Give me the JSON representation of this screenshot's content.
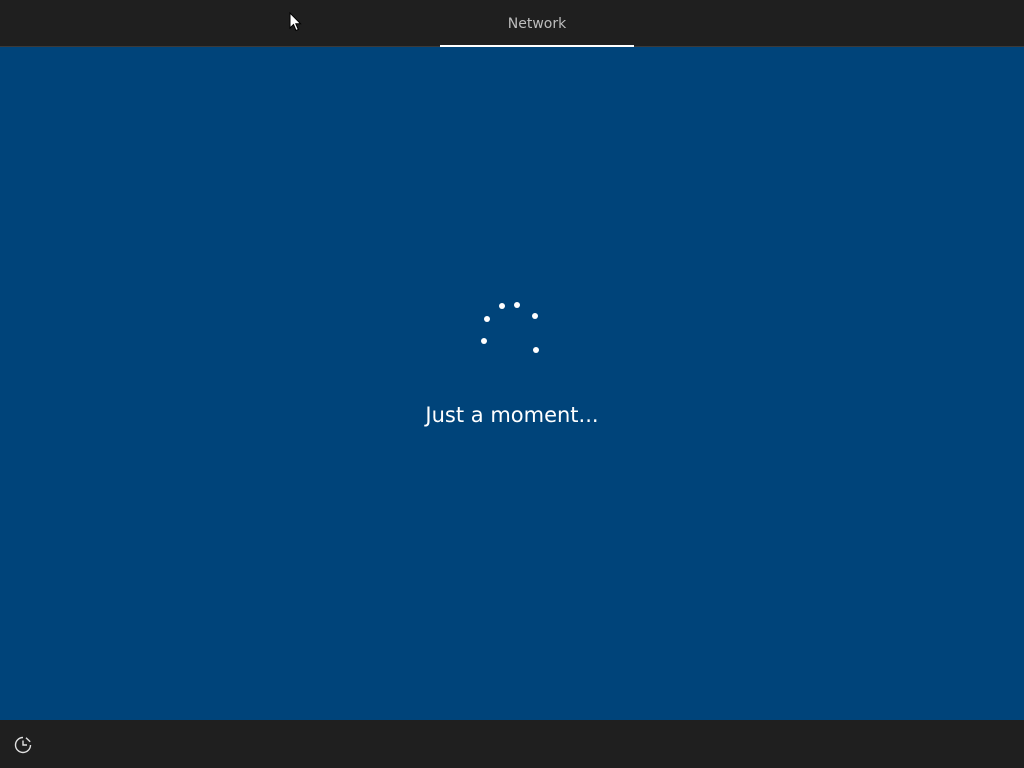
{
  "header": {
    "tabs": [
      {
        "label": "Network",
        "active": true
      }
    ]
  },
  "main": {
    "status_text": "Just a moment...",
    "spinner_icon": "loading-spinner-icon"
  },
  "footer": {
    "ease_of_access_icon": "ease-of-access-icon"
  },
  "colors": {
    "background_main": "#00447a",
    "bar_background": "#1f1f1f",
    "tab_text": "#bdbdbd",
    "accent_underline": "#ffffff",
    "text": "#ffffff"
  }
}
